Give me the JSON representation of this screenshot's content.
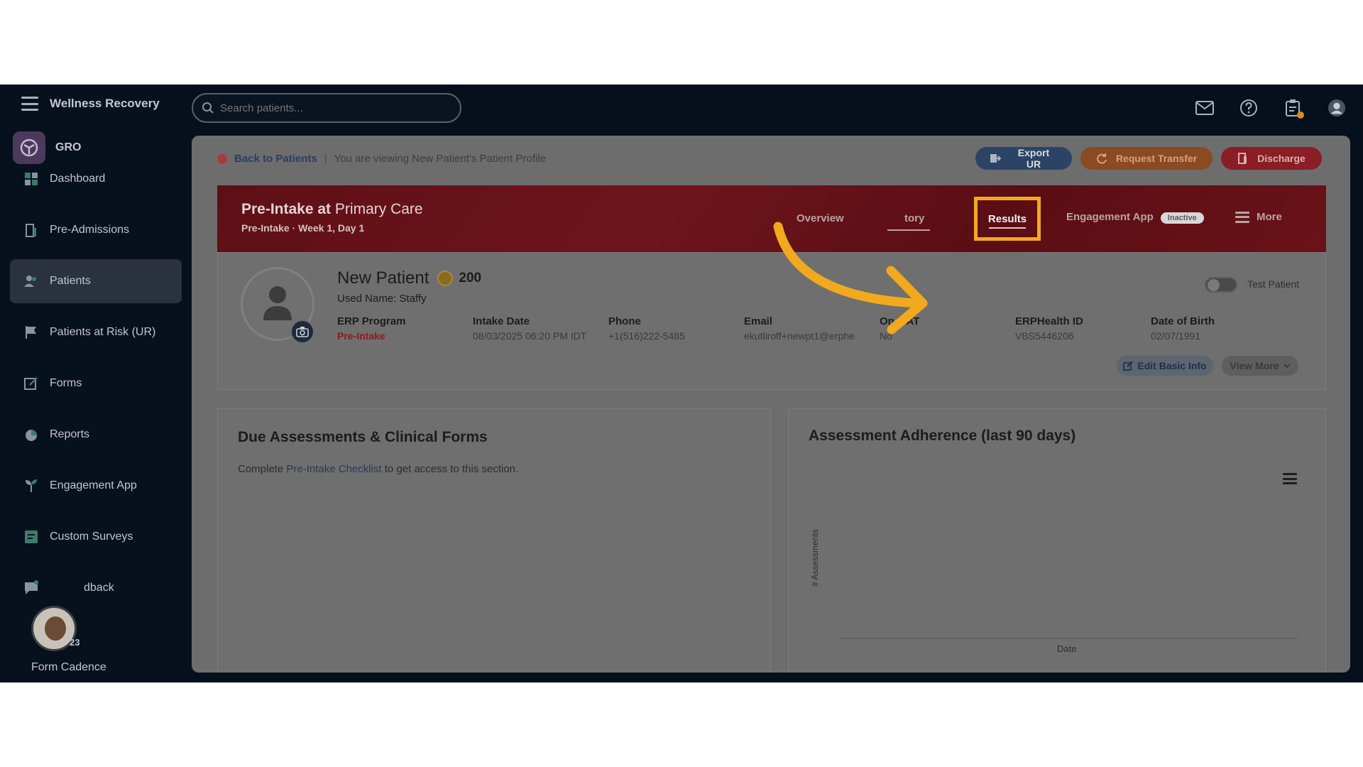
{
  "sidebar": {
    "brand": "Wellness Recovery",
    "org": "GRO",
    "items": [
      {
        "label": "Dashboard",
        "icon": "dashboard-icon"
      },
      {
        "label": "Pre-Admissions",
        "icon": "door-icon"
      },
      {
        "label": "Patients",
        "icon": "users-icon"
      },
      {
        "label": "Patients at Risk (UR)",
        "icon": "flag-icon"
      },
      {
        "label": "Forms",
        "icon": "edit-icon"
      },
      {
        "label": "Reports",
        "icon": "pie-chart-icon"
      },
      {
        "label": "Engagement App",
        "icon": "sprout-icon"
      },
      {
        "label": "Custom Surveys",
        "icon": "survey-icon"
      },
      {
        "label": "dback",
        "icon": "feedback-icon"
      }
    ],
    "active_index": 2,
    "avatar_count": "23",
    "form_cadence": "Form Cadence"
  },
  "topbar": {
    "search_placeholder": "Search patients...",
    "icons": [
      "mail-icon",
      "help-icon",
      "clipboard-icon",
      "user-avatar-icon"
    ]
  },
  "breadcrumb": {
    "back": "Back to Patients",
    "separator": "|",
    "context": "You are viewing New Patient's Patient Profile"
  },
  "actions": {
    "export": "Export UR",
    "transfer": "Request Transfer",
    "discharge": "Discharge"
  },
  "banner": {
    "title_bold": "Pre-Intake at",
    "title_rest": "Primary Care",
    "subtitle": "Pre-Intake · Week 1, Day 1",
    "tabs": {
      "overview": "Overview",
      "history_partial": "tory",
      "results": "Results",
      "engagement": "Engagement App",
      "engagement_badge": "Inactive",
      "more": "More"
    }
  },
  "patient": {
    "name": "New Patient",
    "points": "200",
    "used_name": "Used Name: Staffy",
    "fields": [
      {
        "label": "ERP Program",
        "value": "Pre-Intake"
      },
      {
        "label": "Intake Date",
        "value": "08/03/2025 06:20 PM IDT"
      },
      {
        "label": "Phone",
        "value": "+1(516)222-5485"
      },
      {
        "label": "Email",
        "value": "ekutliroff+newpt1@erphe"
      },
      {
        "label": "On MAT",
        "value": "No"
      },
      {
        "label": "ERPHealth ID",
        "value": "VBS5446206"
      },
      {
        "label": "Date of Birth",
        "value": "02/07/1991"
      }
    ],
    "test_patient_label": "Test Patient",
    "test_patient_on": false,
    "edit_button": "Edit Basic Info",
    "view_more_button": "View More"
  },
  "due_card": {
    "title": "Due Assessments & Clinical Forms",
    "text_before": "Complete",
    "link": "Pre-Intake Checklist",
    "text_after": "to get access to this section."
  },
  "adherence_card": {
    "title": "Assessment Adherence (last 90 days)",
    "chart_data": {
      "type": "bar",
      "title": "Assessment Adherence (last 90 days)",
      "xlabel": "Date",
      "ylabel": "# Assessments",
      "categories": [],
      "values": []
    }
  },
  "colors": {
    "accent_highlight": "#f2a91d",
    "banner_red": "#6e1219",
    "sidebar_bg": "#07111d"
  }
}
